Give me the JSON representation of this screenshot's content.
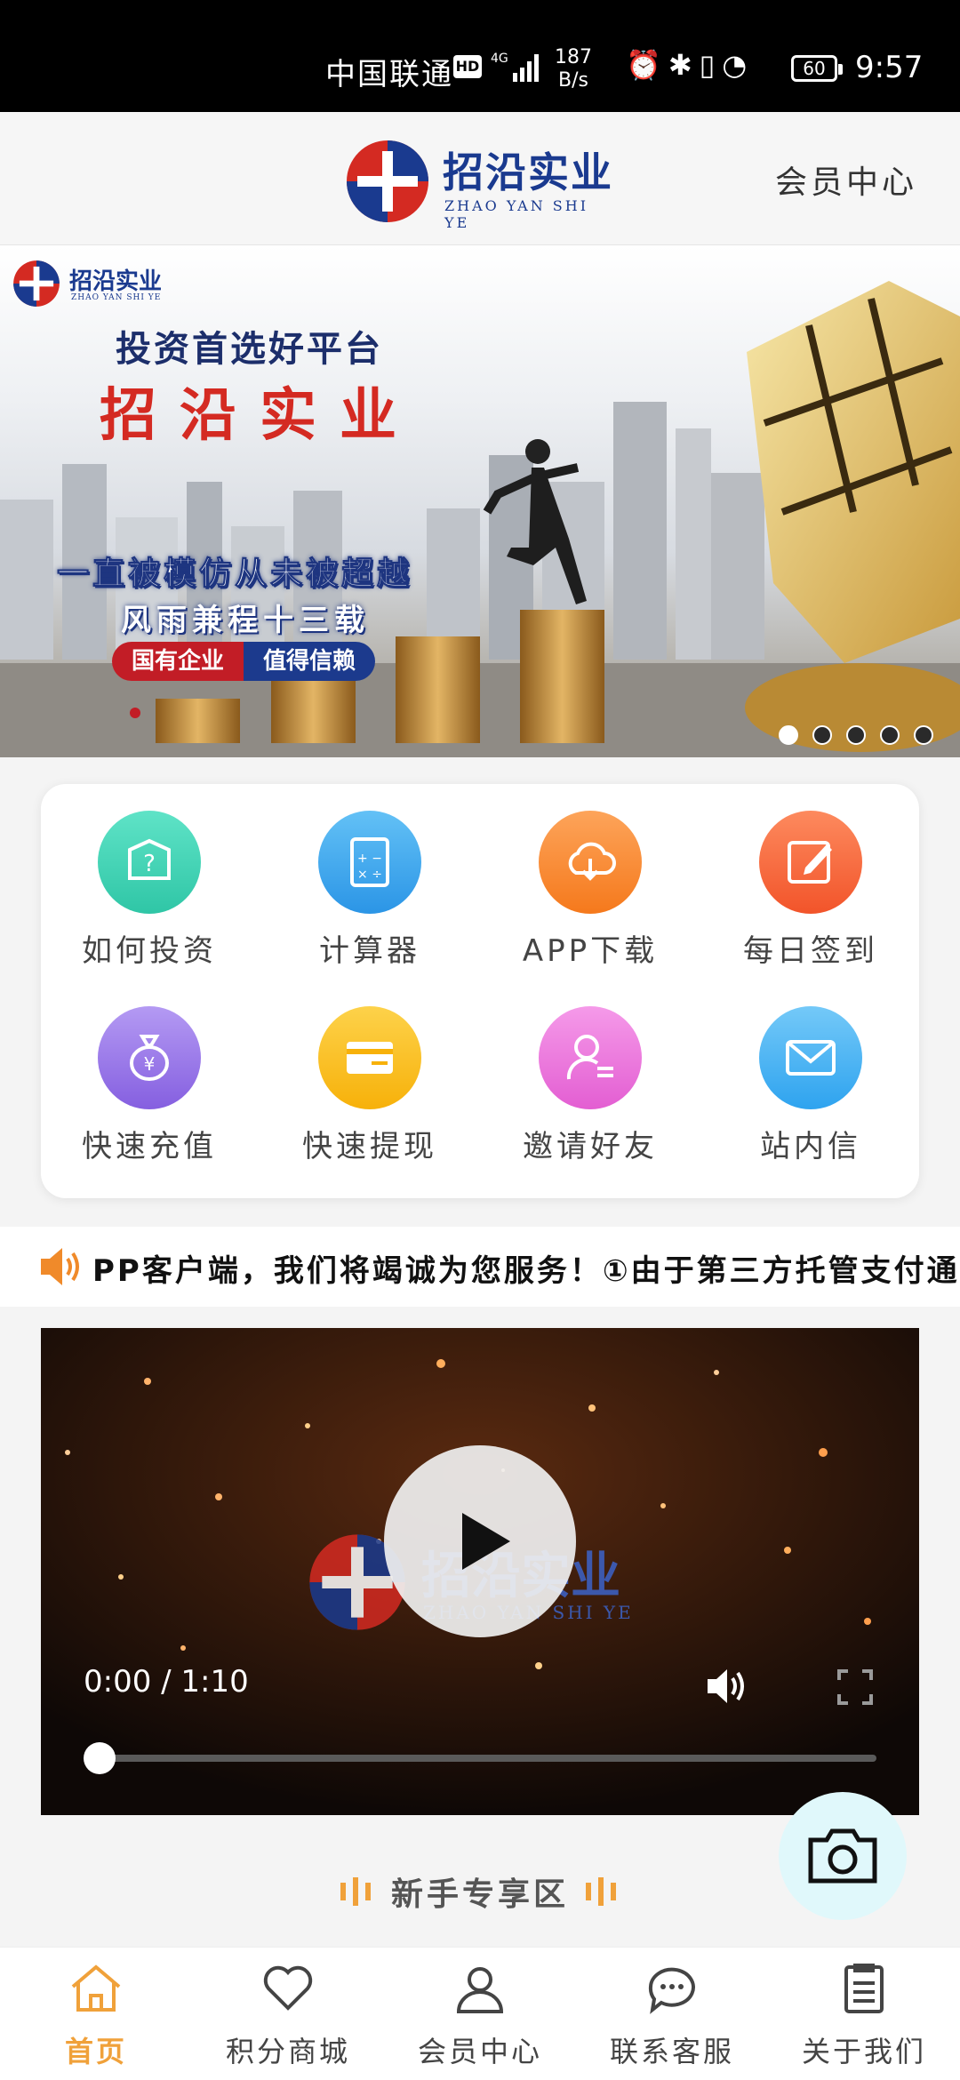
{
  "status_bar": {
    "carrier": "中国联通",
    "hd": "HD",
    "network": "4G",
    "speed_value": "187",
    "speed_unit": "B/s",
    "battery": "60",
    "time": "9:57"
  },
  "header": {
    "logo_cn": "招沿实业",
    "logo_en": "ZHAO YAN SHI YE",
    "member_center": "会员中心"
  },
  "banner": {
    "logo_cn": "招沿实业",
    "logo_en": "ZHAO YAN SHI YE",
    "headline": "投资首选好平台",
    "brand": "招沿实业",
    "slogan1": "一直被模仿从未被超越",
    "slogan2": "风雨兼程十三载",
    "badge1": "国有企业",
    "badge2": "值得信赖",
    "slides": 5,
    "active_slide": 0
  },
  "quick_menu": {
    "items": [
      {
        "label": "如何投资",
        "icon": "question-box-icon",
        "color": "#3fd3b4"
      },
      {
        "label": "计算器",
        "icon": "calculator-icon",
        "color": "#3ea8ef"
      },
      {
        "label": "APP下载",
        "icon": "cloud-download-icon",
        "color": "#fa8c2b"
      },
      {
        "label": "每日签到",
        "icon": "edit-icon",
        "color": "#f86a3c"
      },
      {
        "label": "快速充值",
        "icon": "money-bag-icon",
        "color": "#9b7bea"
      },
      {
        "label": "快速提现",
        "icon": "card-icon",
        "color": "#fbc324"
      },
      {
        "label": "邀请好友",
        "icon": "user-invite-icon",
        "color": "#ee7ce0"
      },
      {
        "label": "站内信",
        "icon": "mail-icon",
        "color": "#4bb6f4"
      }
    ]
  },
  "notice": {
    "text": "PP客户端，我们将竭诚为您服务！①由于第三方托管支付通"
  },
  "video": {
    "time": "0:00 / 1:10",
    "progress": 0,
    "logo_cn": "招沿实业",
    "logo_en": "ZHAO YAN SHI YE"
  },
  "section": {
    "title": "新手专享区"
  },
  "tabbar": {
    "tabs": [
      {
        "label": "首页",
        "icon": "home-icon",
        "active": true
      },
      {
        "label": "积分商城",
        "icon": "heart-icon",
        "active": false
      },
      {
        "label": "会员中心",
        "icon": "user-icon",
        "active": false
      },
      {
        "label": "联系客服",
        "icon": "chat-icon",
        "active": false
      },
      {
        "label": "关于我们",
        "icon": "document-icon",
        "active": false
      }
    ]
  },
  "colors": {
    "accent": "#f0a13a",
    "brand_blue": "#1a3a8f",
    "brand_red": "#d42a22"
  }
}
